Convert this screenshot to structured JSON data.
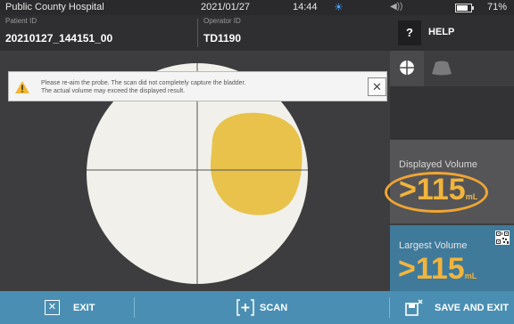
{
  "status_bar": {
    "title": "Public County Hospital",
    "date": "2021/01/27",
    "time": "14:44",
    "battery_percent": "71%"
  },
  "header": {
    "patient_id_label": "Patient ID",
    "patient_id_value": "20210127_144151_00",
    "operator_id_label": "Operator ID",
    "operator_id_value": "TD1190",
    "help_icon": "?",
    "help_label": "HELP"
  },
  "alert": {
    "icon": "warning-icon",
    "line1": "Please re-aim the probe. The scan did not completely capture the bladder.",
    "line2": "The actual volume may exceed the displayed result.",
    "close_glyph": "✕"
  },
  "displayed_volume": {
    "label": "Displayed Volume",
    "value": ">115",
    "unit": "mL"
  },
  "largest_volume": {
    "label": "Largest Volume",
    "value": ">115",
    "unit": "mL"
  },
  "bottom_bar": {
    "exit_label": "EXIT",
    "scan_label": "SCAN",
    "save_exit_label": "SAVE AND EXIT"
  },
  "colors": {
    "accent_blue": "#4a8fb3",
    "volume_orange": "#f3b43c",
    "bladder_yellow": "#e8c24a",
    "scan_circle": "#f1f0ea"
  }
}
